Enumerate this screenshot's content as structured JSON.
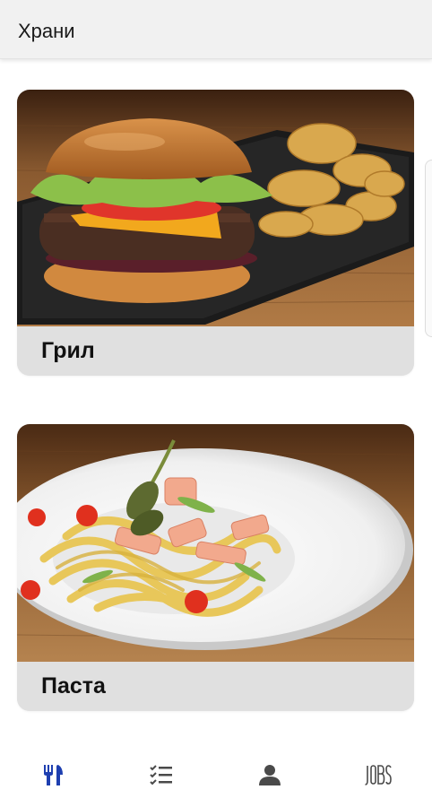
{
  "app_bar": {
    "title": "Храни"
  },
  "categories": [
    {
      "label": "Грил",
      "image": "burger-with-chips-photo"
    },
    {
      "label": "Паста",
      "image": "pasta-plate-photo"
    }
  ],
  "bottom_nav": {
    "active_color": "#1e3fb0",
    "inactive_color": "#4a4a4a",
    "items": [
      {
        "icon": "fork-knife-icon",
        "active": true
      },
      {
        "icon": "checklist-icon",
        "active": false
      },
      {
        "icon": "person-icon",
        "active": false
      },
      {
        "icon": "jobs-logo-icon",
        "active": false,
        "text": "JOBS"
      }
    ]
  }
}
